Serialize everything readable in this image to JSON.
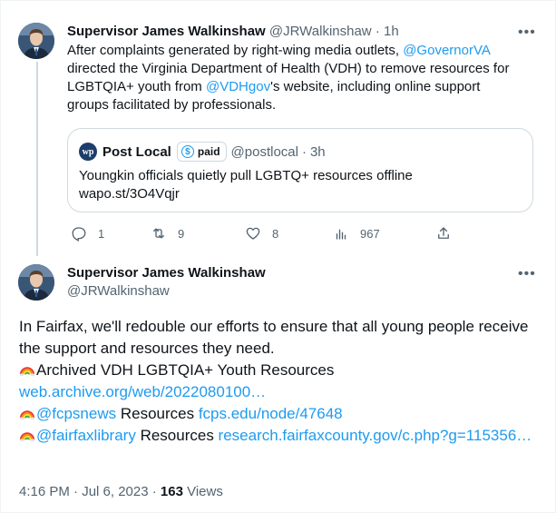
{
  "tweet1": {
    "author_name": "Supervisor James Walkinshaw",
    "handle": "@JRWalkinshaw",
    "separator": "·",
    "time": "1h",
    "text_1": "After complaints generated by right-wing media outlets, ",
    "mention_1": "@GovernorVA",
    "text_2": " directed the Virginia Department of Health (VDH) to remove resources for LGBTQIA+ youth from ",
    "mention_2": "@VDHgov",
    "text_3": "'s website, including online support groups facilitated by professionals.",
    "quote": {
      "logo_text": "wp",
      "name": "Post Local",
      "paid_icon": "$",
      "paid_label": "paid",
      "handle": "@postlocal",
      "separator": "·",
      "time": "3h",
      "headline": "Youngkin officials quietly pull LGBTQ+ resources offline",
      "link": "wapo.st/3O4Vqjr"
    },
    "actions": {
      "replies": "1",
      "retweets": "9",
      "likes": "8",
      "views": "967"
    }
  },
  "tweet2": {
    "author_name": "Supervisor James Walkinshaw",
    "handle": "@JRWalkinshaw",
    "para_1": "In Fairfax, we'll redouble our efforts to ensure that all young people receive the support and resources they need.",
    "line_2_text": "Archived VDH LGBTQIA+ Youth Resources",
    "line_2_link": "web.archive.org/web/2022080100…",
    "line_3_mention": "@fcpsnews",
    "line_3_text": " Resources ",
    "line_3_link": "fcps.edu/node/47648",
    "line_4_mention": "@fairfaxlibrary",
    "line_4_text": " Resources ",
    "line_4_link": "research.fairfaxcounty.gov/c.php?g=115356…",
    "timestamp": "4:16 PM · Jul 6, 2023 · ",
    "views_count": "163",
    "views_label": " Views"
  },
  "icons": {
    "reply": "reply-icon",
    "retweet": "retweet-icon",
    "like": "heart-icon",
    "views": "analytics-icon",
    "share": "share-icon",
    "more": "more-icon",
    "rainbow": "rainbow-emoji"
  },
  "colors": {
    "link": "#1d9bf0",
    "muted": "#536471",
    "text": "#0f1419",
    "border": "#cfd9de"
  }
}
